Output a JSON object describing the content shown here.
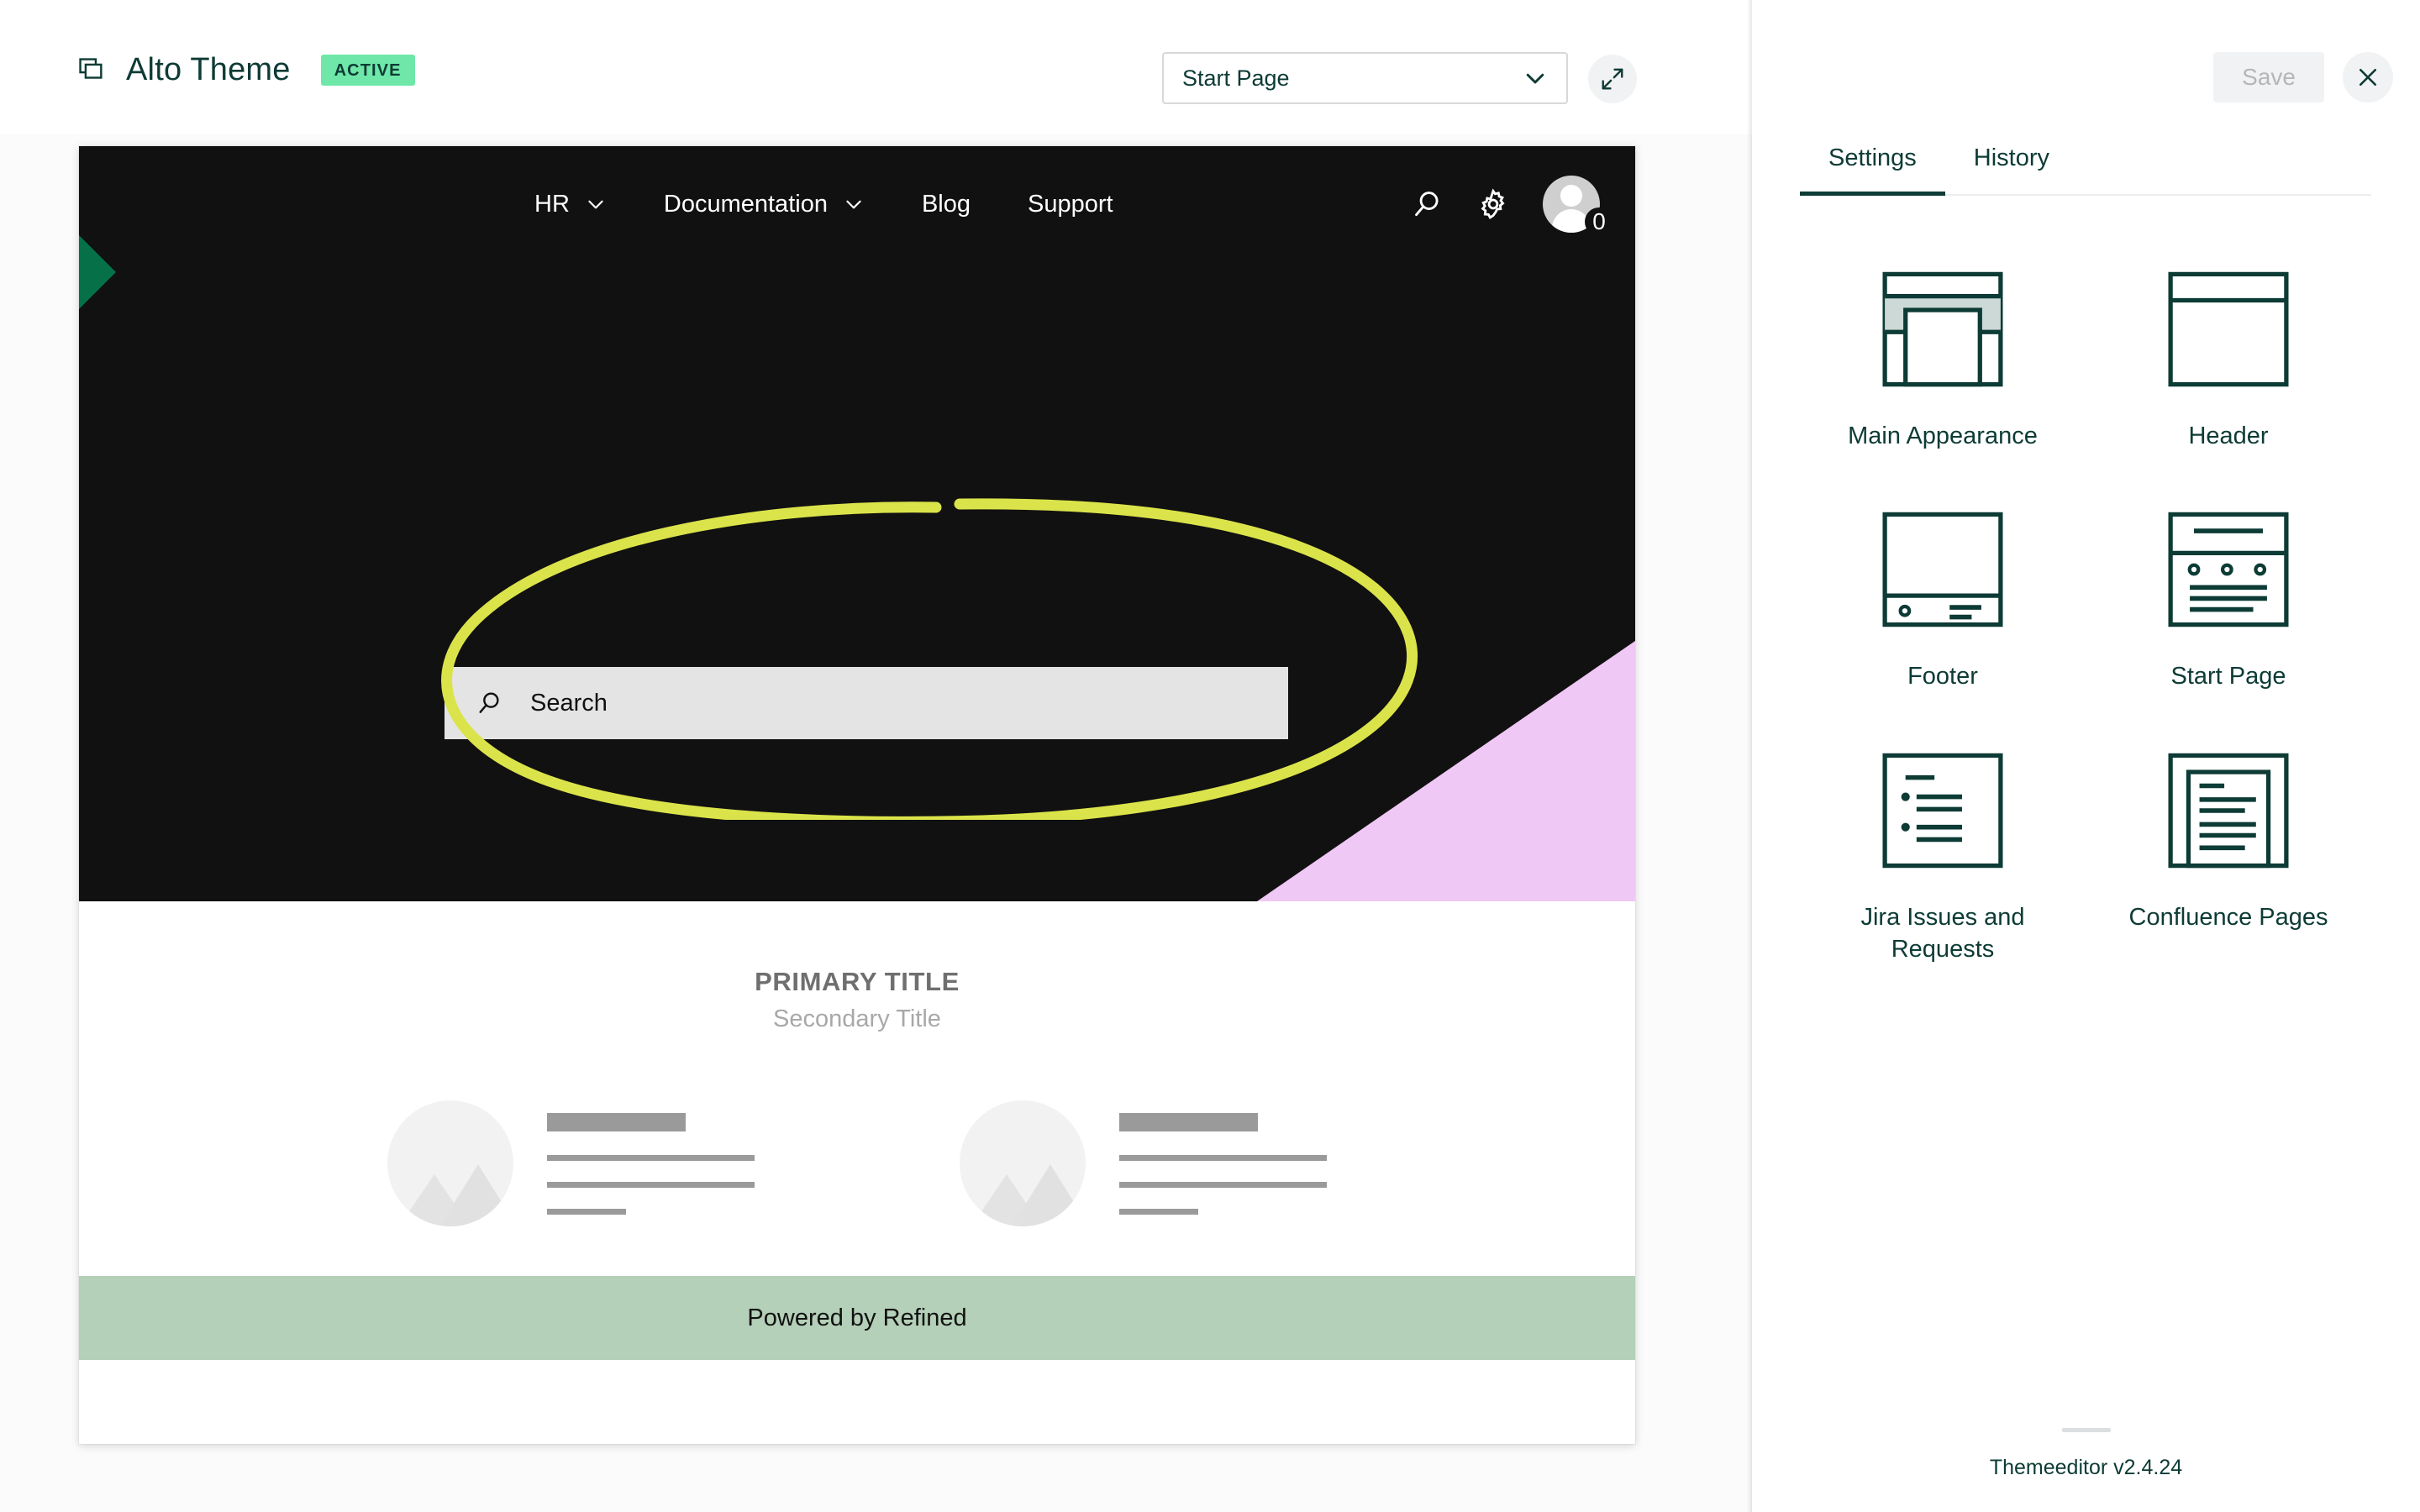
{
  "editor": {
    "theme_name": "Alto Theme",
    "status_badge": "ACTIVE",
    "copy_icon": "copy-icon",
    "page_selector": {
      "value": "Start Page",
      "chevron_icon": "chevron-down-icon"
    },
    "expand_icon": "expand-arrows-icon"
  },
  "preview": {
    "nav": {
      "links": [
        {
          "label": "HR",
          "has_chevron": true
        },
        {
          "label": "Documentation",
          "has_chevron": true
        },
        {
          "label": "Blog",
          "has_chevron": false
        },
        {
          "label": "Support",
          "has_chevron": false
        }
      ],
      "search_icon": "search-icon",
      "settings_icon": "gear-icon",
      "avatar_icon": "avatar",
      "avatar_badge": "0"
    },
    "search": {
      "placeholder": "Search",
      "icon": "search-icon"
    },
    "annotation": {
      "shape": "hand-drawn-ellipse",
      "color": "#dbe34a"
    },
    "content": {
      "primary_title": "PRIMARY TITLE",
      "secondary_title": "Secondary Title",
      "cards": [
        {
          "thumb": "image-placeholder-icon"
        },
        {
          "thumb": "image-placeholder-icon"
        }
      ]
    },
    "footer_text": "Powered by Refined",
    "colors": {
      "hero_background": "#111111",
      "accent_green": "#067148",
      "accent_pink": "#f0c8f5",
      "footer_background": "#b4d0b8",
      "search_background": "#e4e4e4"
    }
  },
  "panel": {
    "save_label": "Save",
    "close_icon": "close-icon",
    "tabs": [
      {
        "label": "Settings",
        "active": true
      },
      {
        "label": "History",
        "active": false
      }
    ],
    "items": [
      {
        "label": "Main Appearance",
        "icon": "main-appearance-icon"
      },
      {
        "label": "Header",
        "icon": "header-icon"
      },
      {
        "label": "Footer",
        "icon": "footer-icon"
      },
      {
        "label": "Start Page",
        "icon": "start-page-icon"
      },
      {
        "label": "Jira Issues and Requests",
        "icon": "jira-issues-icon"
      },
      {
        "label": "Confluence Pages",
        "icon": "confluence-pages-icon"
      }
    ],
    "version": "Themeeditor v2.4.24",
    "accent_color": "#0d3b35"
  }
}
